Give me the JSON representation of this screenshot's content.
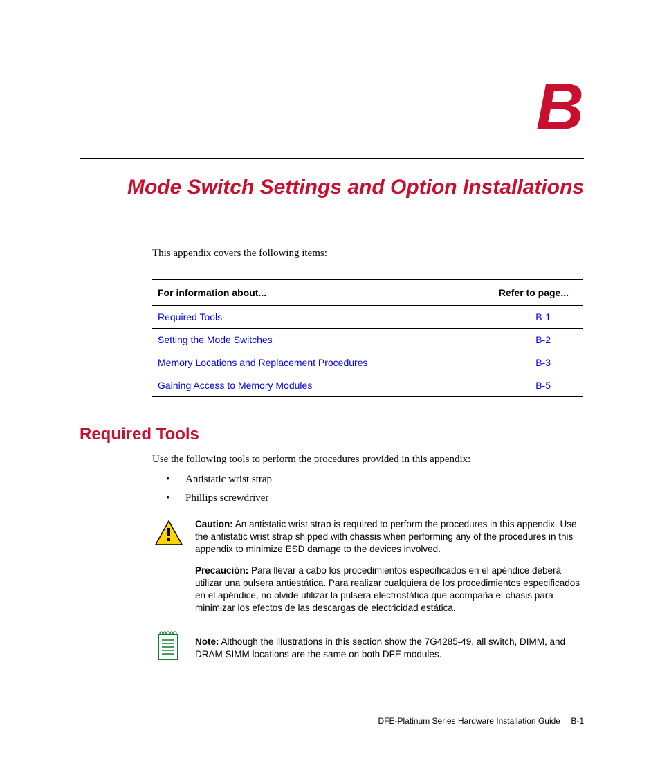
{
  "appendix_letter": "B",
  "chapter_title": "Mode Switch Settings and Option Installations",
  "intro_text": "This appendix covers the following items:",
  "ref_table": {
    "header_info": "For information about...",
    "header_page": "Refer to page...",
    "rows": [
      {
        "topic": "Required Tools",
        "page": "B-1"
      },
      {
        "topic": "Setting the Mode Switches",
        "page": "B-2"
      },
      {
        "topic": "Memory Locations and Replacement Procedures",
        "page": "B-3"
      },
      {
        "topic": "Gaining Access to Memory Modules",
        "page": "B-5"
      }
    ]
  },
  "section_heading": "Required Tools",
  "section_intro": "Use the following tools to perform the procedures provided in this appendix:",
  "bullets": [
    "Antistatic wrist strap",
    "Phillips screwdriver"
  ],
  "caution": {
    "label_en": "Caution:",
    "text_en": "An antistatic wrist strap is required to perform the procedures in this appendix. Use the antistatic wrist strap shipped with chassis when performing any of the procedures in this appendix to minimize ESD damage to the devices involved.",
    "label_es": "Precaución:",
    "text_es": "Para llevar a cabo los procedimientos especificados en el apéndice deberá utilizar una pulsera antiestática. Para realizar cualquiera de los procedimientos especificados en el apéndice, no olvide utilizar la pulsera electrostática que acompaña el chasis para minimizar los efectos de las descargas de electricidad estática."
  },
  "note": {
    "label": "Note:",
    "text": "Although the illustrations in this section show the 7G4285-49, all switch, DIMM, and DRAM SIMM locations are the same on both DFE modules."
  },
  "footer": {
    "doc_title": "DFE-Platinum Series Hardware Installation Guide",
    "page_number": "B-1"
  }
}
